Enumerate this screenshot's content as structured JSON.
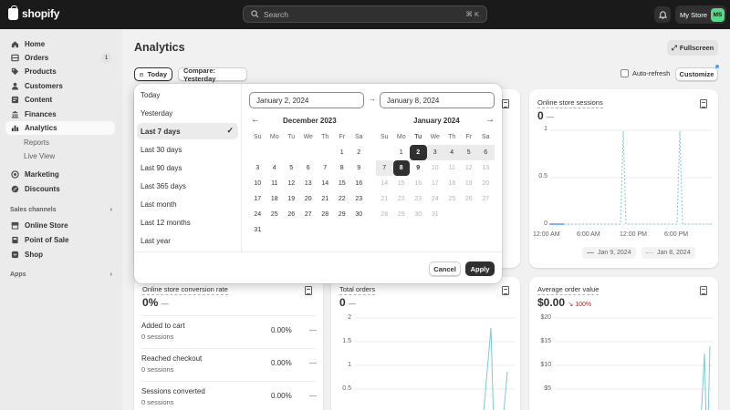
{
  "topbar": {
    "brand": "shopify",
    "search_placeholder": "Search",
    "shortcut": "⌘ K",
    "store_name": "My Store",
    "avatar_initials": "MS"
  },
  "sidebar": {
    "items": [
      {
        "label": "Home",
        "icon": "home-icon"
      },
      {
        "label": "Orders",
        "icon": "orders-icon",
        "badge": "1"
      },
      {
        "label": "Products",
        "icon": "tag-icon"
      },
      {
        "label": "Customers",
        "icon": "person-icon"
      },
      {
        "label": "Content",
        "icon": "content-icon"
      },
      {
        "label": "Finances",
        "icon": "bank-icon"
      },
      {
        "label": "Analytics",
        "icon": "bar-chart-icon"
      },
      {
        "label": "Reports"
      },
      {
        "label": "Live View"
      },
      {
        "label": "Marketing",
        "icon": "target-icon"
      },
      {
        "label": "Discounts",
        "icon": "discount-icon"
      }
    ],
    "sales_channels_heading": "Sales channels",
    "channels": [
      {
        "label": "Online Store",
        "icon": "store-icon"
      },
      {
        "label": "Point of Sale",
        "icon": "pos-icon"
      },
      {
        "label": "Shop",
        "icon": "shop-bag-icon"
      }
    ],
    "apps_heading": "Apps"
  },
  "header": {
    "title": "Analytics",
    "fullscreen": "Fullscreen",
    "date_button": "Today",
    "compare_button": "Compare: Yesterday",
    "auto_refresh": "Auto-refresh",
    "customize": "Customize"
  },
  "datepicker": {
    "presets": [
      "Today",
      "Yesterday",
      "Last 7 days",
      "Last 30 days",
      "Last 90 days",
      "Last 365 days",
      "Last month",
      "Last 12 months",
      "Last year"
    ],
    "selected_preset": "Last 7 days",
    "start_date": "January 2, 2024",
    "end_date": "January 8, 2024",
    "months": [
      "December 2023",
      "January 2024"
    ],
    "weekdays": [
      "Su",
      "Mo",
      "Tu",
      "We",
      "Th",
      "Fr",
      "Sa"
    ],
    "cancel": "Cancel",
    "apply": "Apply"
  },
  "cards": {
    "sessions": {
      "title": "Online store sessions",
      "value": "0",
      "delta": "—",
      "y_ticks": [
        "1",
        "0.5",
        "0"
      ],
      "x_ticks": [
        "12:00 AM",
        "6:00 AM",
        "12:00 PM",
        "6:00 PM"
      ],
      "legend": [
        "Jan 9, 2024",
        "Jan 8, 2024"
      ]
    },
    "conversion": {
      "title": "Online store conversion rate",
      "value": "0%",
      "delta": "—",
      "rows": [
        {
          "label": "Added to cart",
          "sessions": "0 sessions",
          "pct": "0.00%",
          "delta": "—"
        },
        {
          "label": "Reached checkout",
          "sessions": "0 sessions",
          "pct": "0.00%",
          "delta": "—"
        },
        {
          "label": "Sessions converted",
          "sessions": "0 sessions",
          "pct": "0.00%",
          "delta": "—"
        }
      ]
    },
    "orders": {
      "title": "Total orders",
      "value": "0",
      "delta": "—",
      "y_ticks": [
        "2",
        "1.5",
        "1",
        "0.5"
      ]
    },
    "aov": {
      "title": "Average order value",
      "value": "$0.00",
      "delta": "100%",
      "y_ticks": [
        "$20",
        "$15",
        "$10",
        "$5"
      ]
    }
  },
  "colors": {
    "topbar": "#1a1a1a",
    "accent_line": "#7ec8d3",
    "avatar": "#59d889",
    "negative": "#c41e1e"
  }
}
